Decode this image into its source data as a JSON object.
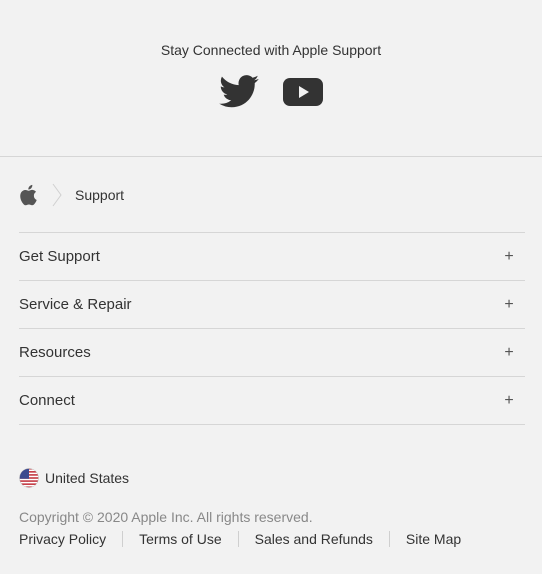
{
  "social": {
    "title": "Stay Connected with Apple Support",
    "icons": [
      "twitter-icon",
      "youtube-icon"
    ]
  },
  "breadcrumb": {
    "home_icon": "apple-icon",
    "separator_icon": "chevron-right-icon",
    "current": "Support"
  },
  "accordion": {
    "items": [
      {
        "label": "Get Support",
        "expand": "+"
      },
      {
        "label": "Service & Repair",
        "expand": "+"
      },
      {
        "label": "Resources",
        "expand": "+"
      },
      {
        "label": "Connect",
        "expand": "+"
      }
    ]
  },
  "locale": {
    "flag_icon": "us-flag-icon",
    "label": "United States"
  },
  "footer": {
    "copyright": "Copyright © 2020 Apple Inc. All rights reserved.",
    "links": [
      "Privacy Policy",
      "Terms of Use",
      "Sales and Refunds",
      "Site Map"
    ]
  },
  "colors": {
    "background": "#f2f2f2",
    "text": "#333333",
    "muted": "#888888",
    "divider": "#d6d6d6"
  }
}
